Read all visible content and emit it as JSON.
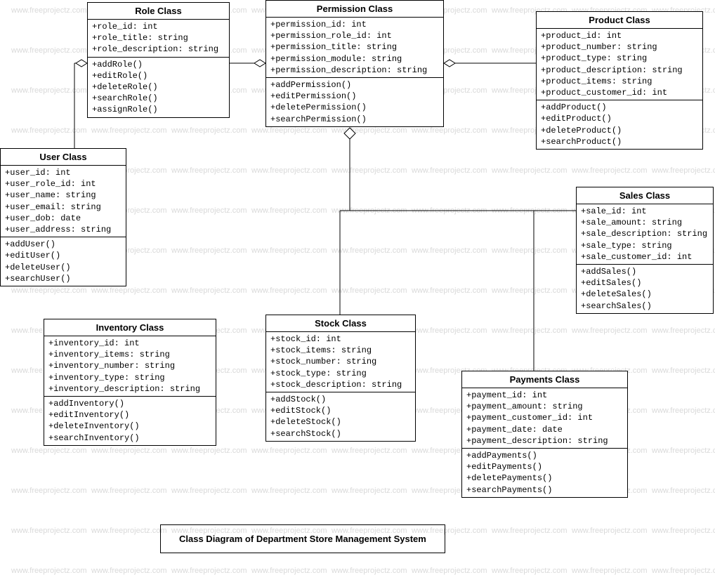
{
  "title": "Class Diagram of Department Store Management System",
  "watermark": "www.freeprojectz.com",
  "classes": {
    "role": {
      "title": "Role Class",
      "attrs": [
        "+role_id: int",
        "+role_title: string",
        "+role_description: string"
      ],
      "ops": [
        "+addRole()",
        "+editRole()",
        "+deleteRole()",
        "+searchRole()",
        "+assignRole()"
      ]
    },
    "permission": {
      "title": "Permission Class",
      "attrs": [
        "+permission_id: int",
        "+permission_role_id: int",
        "+permission_title: string",
        "+permission_module: string",
        "+permission_description: string"
      ],
      "ops": [
        "+addPermission()",
        "+editPermission()",
        "+deletePermission()",
        "+searchPermission()"
      ]
    },
    "product": {
      "title": "Product Class",
      "attrs": [
        "+product_id: int",
        "+product_number: string",
        "+product_type: string",
        "+product_description: string",
        "+product_items: string",
        "+product_customer_id: int"
      ],
      "ops": [
        "+addProduct()",
        "+editProduct()",
        "+deleteProduct()",
        "+searchProduct()"
      ]
    },
    "user": {
      "title": "User Class",
      "attrs": [
        "+user_id: int",
        "+user_role_id: int",
        "+user_name: string",
        "+user_email: string",
        "+user_dob: date",
        "+user_address: string"
      ],
      "ops": [
        "+addUser()",
        "+editUser()",
        "+deleteUser()",
        "+searchUser()"
      ]
    },
    "sales": {
      "title": "Sales Class",
      "attrs": [
        "+sale_id: int",
        "+sale_amount: string",
        "+sale_description: string",
        "+sale_type: string",
        "+sale_customer_id: int"
      ],
      "ops": [
        "+addSales()",
        "+editSales()",
        "+deleteSales()",
        "+searchSales()"
      ]
    },
    "inventory": {
      "title": "Inventory Class",
      "attrs": [
        "+inventory_id: int",
        "+inventory_items: string",
        "+inventory_number: string",
        "+inventory_type: string",
        "+inventory_description: string"
      ],
      "ops": [
        "+addInventory()",
        "+editInventory()",
        "+deleteInventory()",
        "+searchInventory()"
      ]
    },
    "stock": {
      "title": "Stock Class",
      "attrs": [
        "+stock_id: int",
        "+stock_items: string",
        "+stock_number: string",
        "+stock_type: string",
        "+stock_description: string"
      ],
      "ops": [
        "+addStock()",
        "+editStock()",
        "+deleteStock()",
        "+searchStock()"
      ]
    },
    "payments": {
      "title": "Payments Class",
      "attrs": [
        "+payment_id: int",
        "+payment_amount: string",
        "+payment_customer_id: int",
        "+payment_date: date",
        "+payment_description: string"
      ],
      "ops": [
        "+addPayments()",
        "+editPayments()",
        "+deletePayments()",
        "+searchPayments()"
      ]
    }
  },
  "chart_data": {
    "type": "table",
    "diagram_type": "UML Class Diagram",
    "title": "Class Diagram of Department Store Management System",
    "classes": [
      {
        "name": "Role Class",
        "attributes": [
          "role_id: int",
          "role_title: string",
          "role_description: string"
        ],
        "operations": [
          "addRole()",
          "editRole()",
          "deleteRole()",
          "searchRole()",
          "assignRole()"
        ]
      },
      {
        "name": "Permission Class",
        "attributes": [
          "permission_id: int",
          "permission_role_id: int",
          "permission_title: string",
          "permission_module: string",
          "permission_description: string"
        ],
        "operations": [
          "addPermission()",
          "editPermission()",
          "deletePermission()",
          "searchPermission()"
        ]
      },
      {
        "name": "Product Class",
        "attributes": [
          "product_id: int",
          "product_number: string",
          "product_type: string",
          "product_description: string",
          "product_items: string",
          "product_customer_id: int"
        ],
        "operations": [
          "addProduct()",
          "editProduct()",
          "deleteProduct()",
          "searchProduct()"
        ]
      },
      {
        "name": "User Class",
        "attributes": [
          "user_id: int",
          "user_role_id: int",
          "user_name: string",
          "user_email: string",
          "user_dob: date",
          "user_address: string"
        ],
        "operations": [
          "addUser()",
          "editUser()",
          "deleteUser()",
          "searchUser()"
        ]
      },
      {
        "name": "Sales Class",
        "attributes": [
          "sale_id: int",
          "sale_amount: string",
          "sale_description: string",
          "sale_type: string",
          "sale_customer_id: int"
        ],
        "operations": [
          "addSales()",
          "editSales()",
          "deleteSales()",
          "searchSales()"
        ]
      },
      {
        "name": "Inventory Class",
        "attributes": [
          "inventory_id: int",
          "inventory_items: string",
          "inventory_number: string",
          "inventory_type: string",
          "inventory_description: string"
        ],
        "operations": [
          "addInventory()",
          "editInventory()",
          "deleteInventory()",
          "searchInventory()"
        ]
      },
      {
        "name": "Stock Class",
        "attributes": [
          "stock_id: int",
          "stock_items: string",
          "stock_number: string",
          "stock_type: string",
          "stock_description: string"
        ],
        "operations": [
          "addStock()",
          "editStock()",
          "deleteStock()",
          "searchStock()"
        ]
      },
      {
        "name": "Payments Class",
        "attributes": [
          "payment_id: int",
          "payment_amount: string",
          "payment_customer_id: int",
          "payment_date: date",
          "payment_description: string"
        ],
        "operations": [
          "addPayments()",
          "editPayments()",
          "deletePayments()",
          "searchPayments()"
        ]
      }
    ],
    "relationships": [
      {
        "from": "Role Class",
        "to": "User Class",
        "type": "aggregation",
        "diamond_at": "Role Class"
      },
      {
        "from": "Permission Class",
        "to": "Role Class",
        "type": "aggregation",
        "diamond_at": "Permission Class"
      },
      {
        "from": "Permission Class",
        "to": "Product Class",
        "type": "aggregation",
        "diamond_at": "Permission Class"
      },
      {
        "from": "Permission Class",
        "to": "Stock Class",
        "type": "aggregation",
        "diamond_at": "Permission Class"
      },
      {
        "from": "Permission Class",
        "to": "Sales Class",
        "type": "aggregation",
        "diamond_at": "Permission Class"
      },
      {
        "from": "Permission Class",
        "to": "Payments Class",
        "type": "aggregation",
        "diamond_at": "Permission Class"
      }
    ]
  }
}
